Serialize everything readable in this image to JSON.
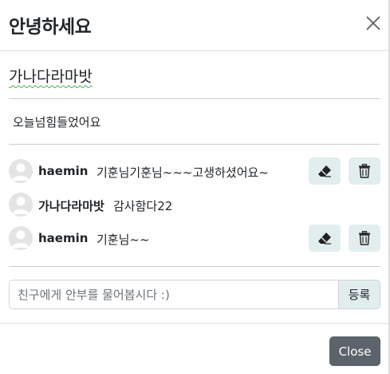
{
  "modal": {
    "title": "안녕하세요",
    "close_icon": "close-x-icon"
  },
  "post": {
    "title": "가나다라마밧",
    "content": "오늘넘힘들었어요"
  },
  "comments": [
    {
      "author": "haemin",
      "text": "기훈님기훈님~~~고생하셨어요~",
      "can_edit": true,
      "edit_icon": "eraser-icon",
      "delete_icon": "trash-icon"
    },
    {
      "author": "가나다라마밧",
      "text": "감사함다22",
      "can_edit": false
    },
    {
      "author": "haemin",
      "text": "기훈님~~",
      "can_edit": true,
      "edit_icon": "eraser-icon",
      "delete_icon": "trash-icon"
    }
  ],
  "comment_form": {
    "placeholder": "친구에게 안부를 물어봅시다 :)",
    "value": "",
    "submit_label": "등록"
  },
  "footer": {
    "close_label": "Close"
  },
  "colors": {
    "icon_button_bg": "#e2eeee",
    "close_button_bg": "#5c636a",
    "divider": "#c9ced3"
  }
}
